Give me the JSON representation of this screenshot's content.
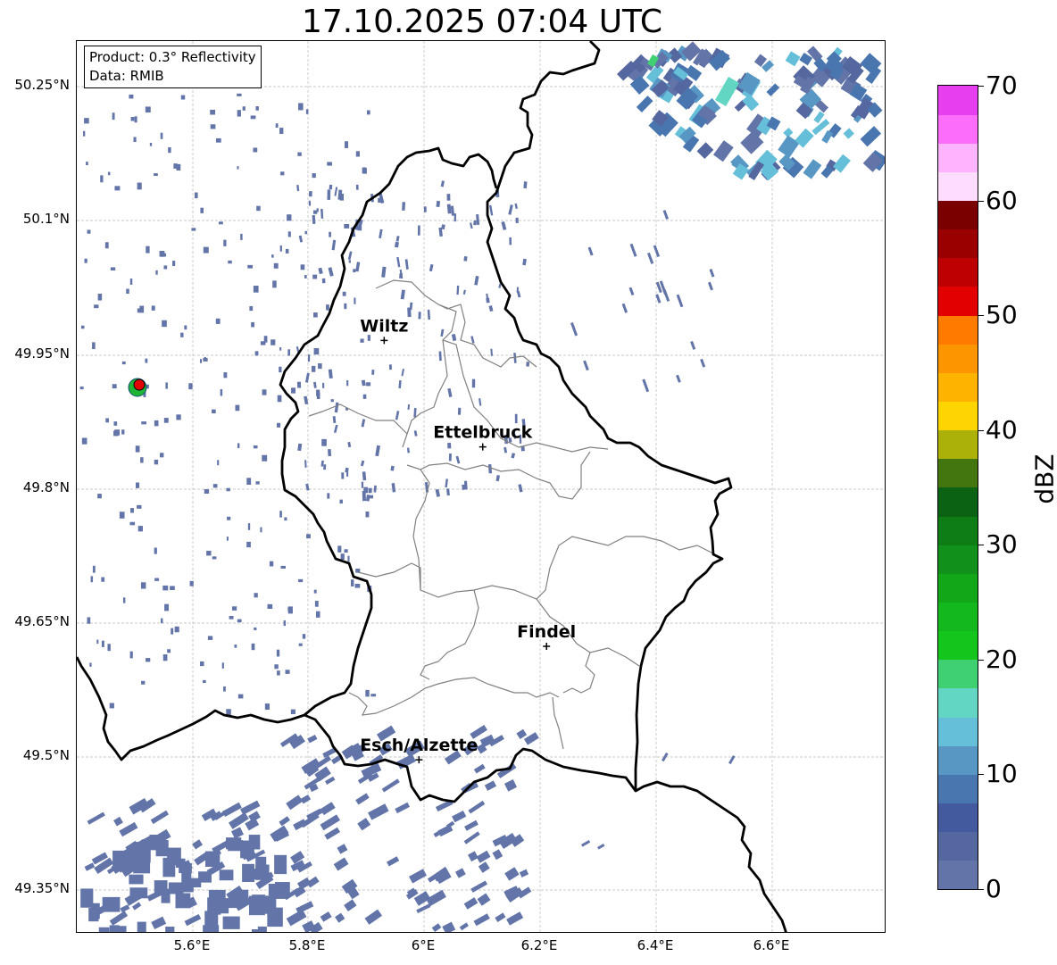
{
  "title": "17.10.2025 07:04 UTC",
  "info": {
    "product": "Product: 0.3° Reflectivity",
    "data_source": "Data: RMIB"
  },
  "axes": {
    "lat_ticks": [
      "50.25°N",
      "50.1°N",
      "49.95°N",
      "49.8°N",
      "49.65°N",
      "49.5°N",
      "49.35°N"
    ],
    "lon_ticks": [
      "5.6°E",
      "5.8°E",
      "6°E",
      "6.2°E",
      "6.4°E",
      "6.6°E"
    ]
  },
  "colorbar": {
    "label": "dBZ",
    "ticks": [
      "0",
      "10",
      "20",
      "30",
      "40",
      "50",
      "60",
      "70"
    ],
    "colors": [
      "#6375a8",
      "#55679f",
      "#435a9e",
      "#4a76b0",
      "#5897c4",
      "#66bfd8",
      "#62d6c3",
      "#3fd171",
      "#14c51c",
      "#12b81c",
      "#12a718",
      "#11911b",
      "#0f7d16",
      "#0b6212",
      "#43760e",
      "#acb109",
      "#ffd500",
      "#fdb300",
      "#fd9500",
      "#ff7b00",
      "#e20000",
      "#bd0000",
      "#9b0000",
      "#7a0000",
      "#fedcff",
      "#feb3ff",
      "#fd6dfb",
      "#e73ef0"
    ]
  },
  "cities": [
    {
      "name": "Wiltz",
      "lon": 5.93,
      "lat": 49.966
    },
    {
      "name": "Ettelbruck",
      "lon": 6.1,
      "lat": 49.847
    },
    {
      "name": "Findel",
      "lon": 6.21,
      "lat": 49.624
    },
    {
      "name": "Esch/Alzette",
      "lon": 5.99,
      "lat": 49.497
    }
  ],
  "radar_site": {
    "lon": 5.505,
    "lat": 49.915
  }
}
